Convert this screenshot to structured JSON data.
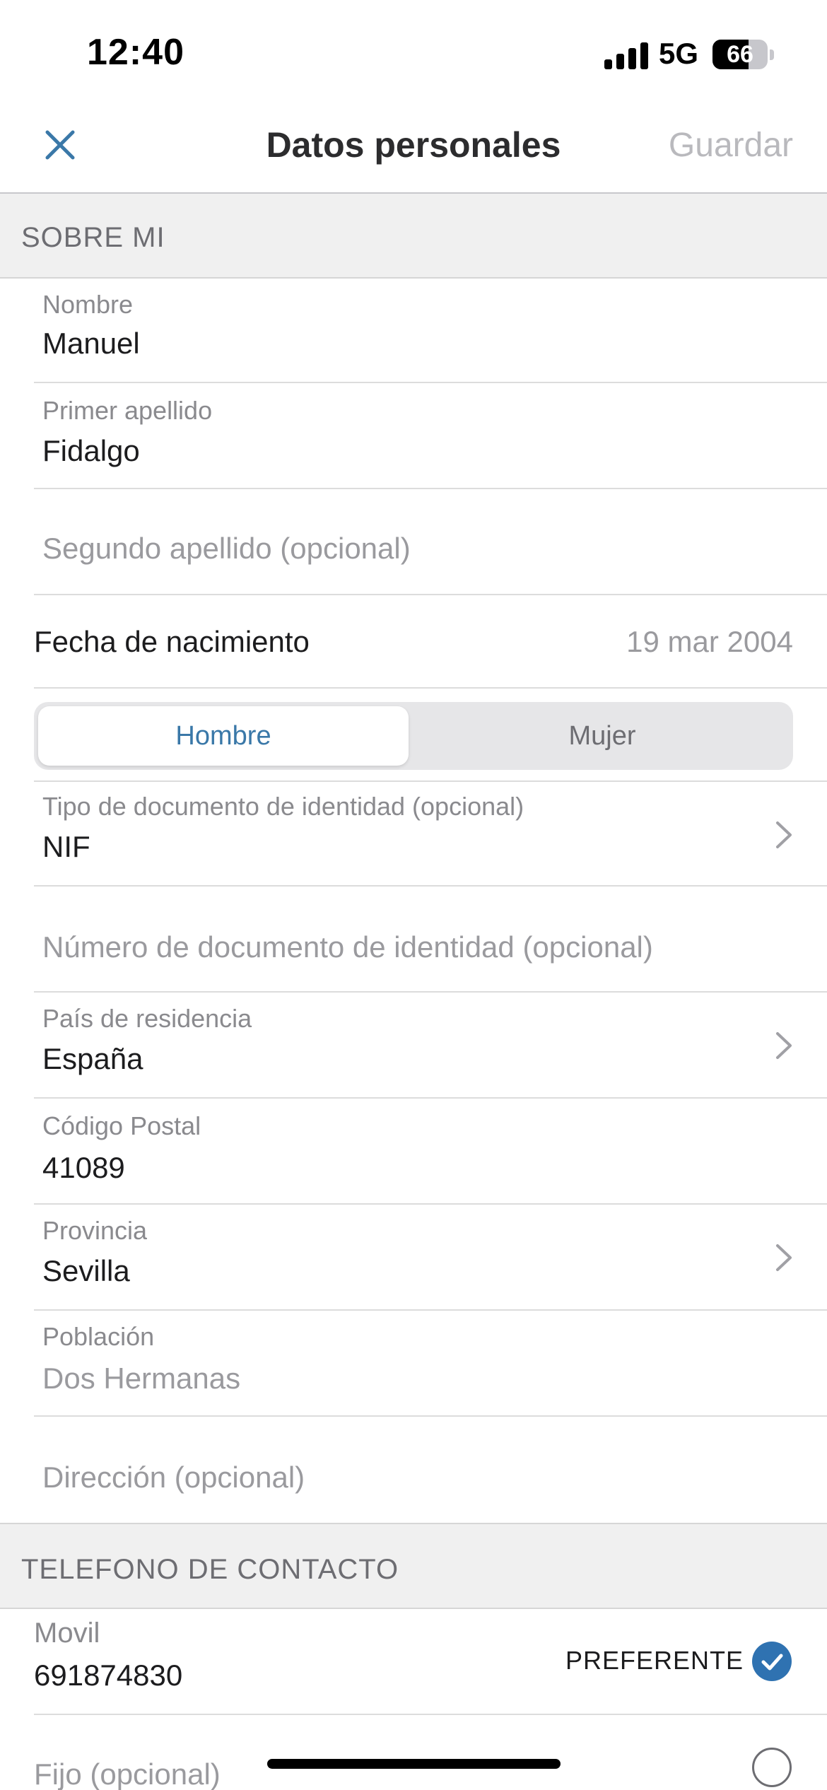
{
  "status_bar": {
    "time": "12:40",
    "network": "5G",
    "battery": "66",
    "battery_level": 0.66
  },
  "nav": {
    "title": "Datos personales",
    "save_label": "Guardar",
    "close_icon": "close-icon"
  },
  "sections": {
    "about_me": "SOBRE MI",
    "phone": "TELEFONO DE CONTACTO"
  },
  "fields": {
    "nombre": {
      "label": "Nombre",
      "value": "Manuel"
    },
    "primer_apellido": {
      "label": "Primer apellido",
      "value": "Fidalgo"
    },
    "segundo_apellido": {
      "placeholder": "Segundo apellido (opcional)"
    },
    "fecha_nacimiento": {
      "label": "Fecha de nacimiento",
      "value": "19 mar 2004"
    },
    "tipo_documento": {
      "label": "Tipo de documento de identidad (opcional)",
      "value": "NIF"
    },
    "numero_documento": {
      "placeholder": "Número de documento de identidad (opcional)"
    },
    "pais": {
      "label": "País de residencia",
      "value": "España"
    },
    "codigo_postal": {
      "label": "Código Postal",
      "value": "41089"
    },
    "provincia": {
      "label": "Provincia",
      "value": "Sevilla"
    },
    "poblacion": {
      "label": "Población",
      "value": "Dos Hermanas"
    },
    "direccion": {
      "placeholder": "Dirección (opcional)"
    }
  },
  "gender": {
    "options": [
      "Hombre",
      "Mujer"
    ],
    "selected": "Hombre"
  },
  "phones": {
    "movil": {
      "label": "Movil",
      "value": "691874830",
      "preferred_label": "PREFERENTE",
      "preferred": true
    },
    "fijo": {
      "placeholder": "Fijo (opcional)",
      "preferred": false
    }
  },
  "colors": {
    "accent": "#3a78a8",
    "check": "#2f72b1",
    "section_bg": "#f0f0f0"
  }
}
